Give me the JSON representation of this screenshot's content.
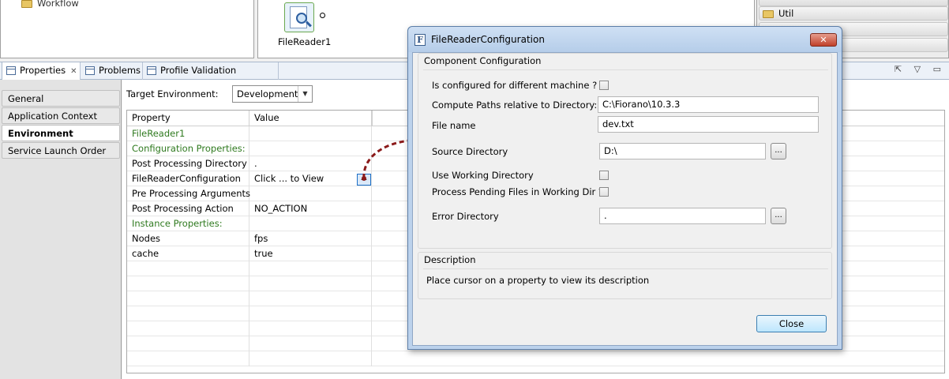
{
  "explorer": {
    "workflow_item": "Workflow"
  },
  "canvas": {
    "component_label": "FileReader1"
  },
  "palette": {
    "items": [
      "Util"
    ]
  },
  "tabs": [
    {
      "label": "Properties",
      "close": "✕"
    },
    {
      "label": "Problems"
    },
    {
      "label": "Profile Validation Messages"
    }
  ],
  "toolbar_icons": "⇱ ▽ ▭",
  "nav": {
    "items": [
      "General",
      "Application Context",
      "Environment Properties",
      "Service Launch Order"
    ],
    "selected": "Environment Properties"
  },
  "target_env": {
    "label": "Target Environment:",
    "value": "Development",
    "arrow": "▼"
  },
  "grid": {
    "headers": [
      "Property",
      "Value"
    ],
    "rows": [
      {
        "property": "FileReader1",
        "value": "",
        "style": "group"
      },
      {
        "property": "Configuration Properties:",
        "value": "",
        "style": "group"
      },
      {
        "property": "Post Processing Directory",
        "value": ".",
        "style": "normal"
      },
      {
        "property": "FileReaderConfiguration",
        "value": "Click ... to View",
        "style": "normal"
      },
      {
        "property": "Pre Processing Arguments",
        "value": "",
        "style": "normal"
      },
      {
        "property": "Post Processing Action",
        "value": "NO_ACTION",
        "style": "normal"
      },
      {
        "property": "Instance Properties:",
        "value": "",
        "style": "group"
      },
      {
        "property": "Nodes",
        "value": "fps",
        "style": "normal"
      },
      {
        "property": "cache",
        "value": "true",
        "style": "normal"
      }
    ],
    "ellipsis": "..."
  },
  "dialog": {
    "title": "FileReaderConfiguration",
    "icon_letter": "F",
    "close_x": "✕",
    "component_group_title": "Component Configuration",
    "fields": {
      "different_machine_label": "Is configured for different machine ?",
      "compute_paths_label": "Compute Paths relative to Directory:",
      "compute_paths_value": "C:\\Fiorano\\10.3.3",
      "file_name_label": "File name",
      "file_name_value": "dev.txt",
      "source_dir_label": "Source Directory",
      "source_dir_value": "D:\\",
      "use_working_dir_label": "Use Working Directory",
      "process_pending_label": "Process Pending Files in Working Dir ?",
      "error_dir_label": "Error Directory",
      "error_dir_value": "."
    },
    "browse_label": "...",
    "description_title": "Description",
    "description_text": "Place cursor on a property to view its description",
    "close_button": "Close"
  }
}
